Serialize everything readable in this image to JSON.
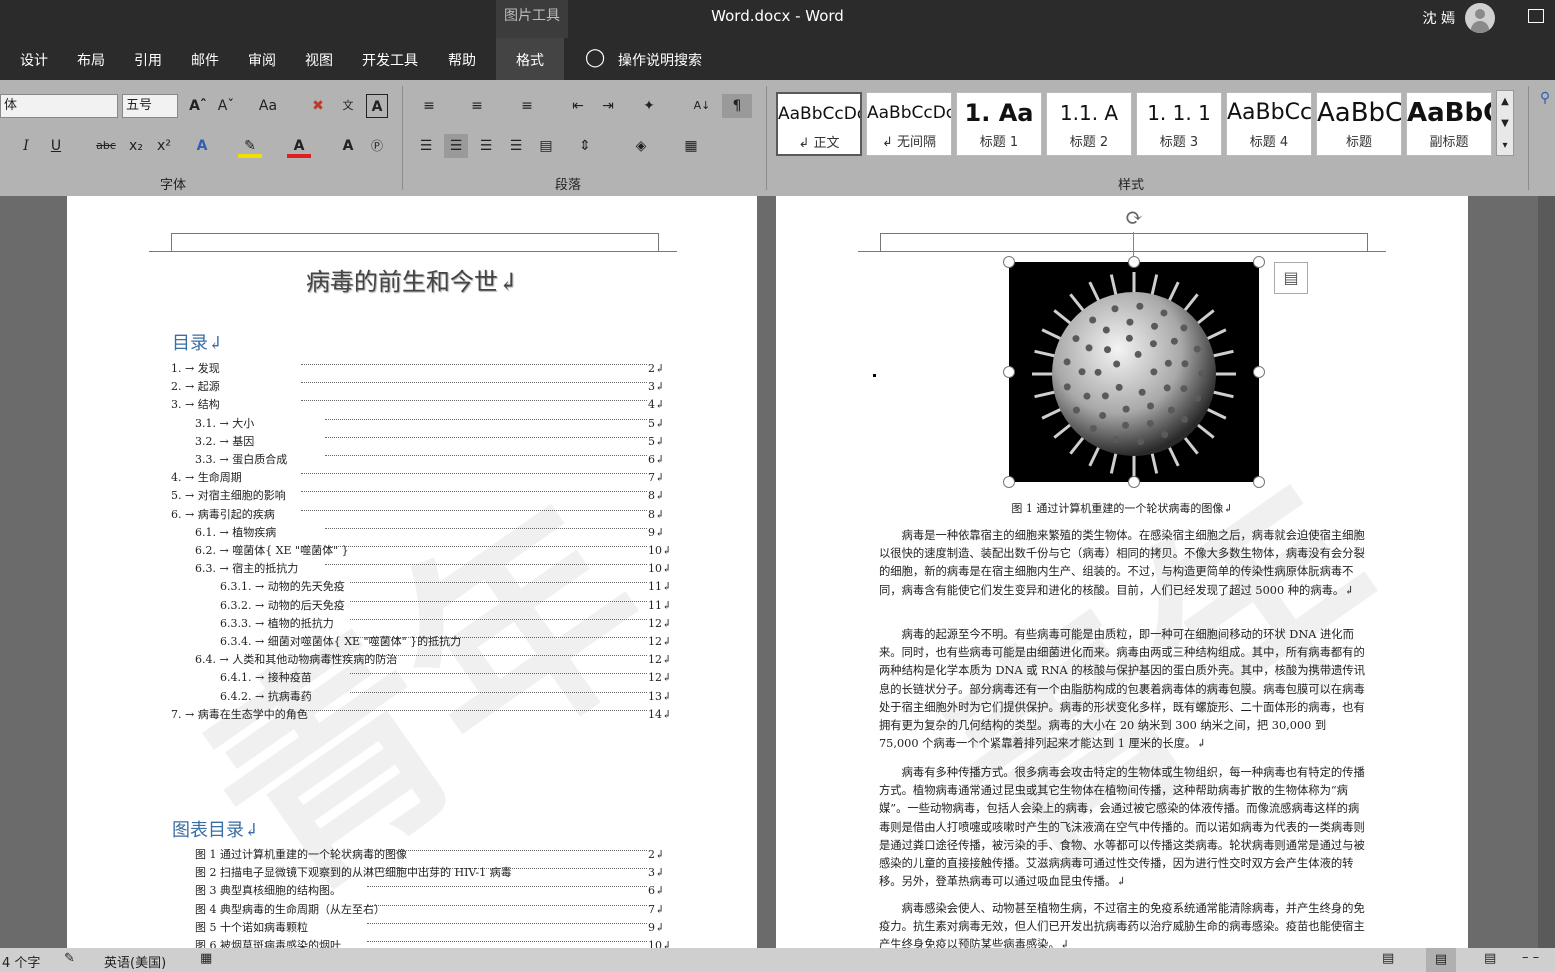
{
  "window": {
    "title": "Word.docx  -  Word",
    "user": "沈 嫣",
    "context_tab": "图片工具"
  },
  "tabs": [
    "设计",
    "布局",
    "引用",
    "邮件",
    "审阅",
    "视图",
    "开发工具",
    "帮助",
    "格式"
  ],
  "tell_me": "操作说明搜索",
  "font": {
    "name": "体",
    "size": "五号",
    "group_label": "字体",
    "aa": "Aa",
    "strike": "abc",
    "sub": "x₂",
    "sup": "x²",
    "A": "A"
  },
  "paragraph": {
    "group_label": "段落"
  },
  "styles": {
    "group_label": "样式",
    "items": [
      {
        "preview": "AaBbCcDc",
        "name": "↲ 正文"
      },
      {
        "preview": "AaBbCcDc",
        "name": "↲ 无间隔"
      },
      {
        "preview": "1.  Aa",
        "name": "标题 1"
      },
      {
        "preview": "1.1.  A",
        "name": "标题 2"
      },
      {
        "preview": "1. 1. 1",
        "name": "标题 3"
      },
      {
        "preview": "AaBbCc",
        "name": "标题 4"
      },
      {
        "preview": "AaBbC",
        "name": "标题"
      },
      {
        "preview": "AaBbC",
        "name": "副标题"
      }
    ]
  },
  "left_page": {
    "doc_title": "病毒的前生和今世↲",
    "toc_heading": "目录↲",
    "toc": [
      {
        "text": "1. → 发现",
        "page": "2↲",
        "level": 0
      },
      {
        "text": "2. → 起源",
        "page": "3↲",
        "level": 0
      },
      {
        "text": "3. → 结构",
        "page": "4↲",
        "level": 0
      },
      {
        "text": "3.1. → 大小",
        "page": "5↲",
        "level": 1
      },
      {
        "text": "3.2. → 基因",
        "page": "5↲",
        "level": 1
      },
      {
        "text": "3.3. → 蛋白质合成",
        "page": "6↲",
        "level": 1
      },
      {
        "text": "4. → 生命周期",
        "page": "7↲",
        "level": 0
      },
      {
        "text": "5. → 对宿主细胞的影响",
        "page": "8↲",
        "level": 0
      },
      {
        "text": "6. → 病毒引起的疾病",
        "page": "8↲",
        "level": 0
      },
      {
        "text": "6.1. → 植物疾病",
        "page": "9↲",
        "level": 1
      },
      {
        "text": "6.2. → 噬菌体{ XE \"噬菌体\" }",
        "page": "10↲",
        "level": 1
      },
      {
        "text": "6.3. → 宿主的抵抗力",
        "page": "10↲",
        "level": 1
      },
      {
        "text": "6.3.1. → 动物的先天免疫",
        "page": "11↲",
        "level": 2
      },
      {
        "text": "6.3.2. → 动物的后天免疫",
        "page": "11↲",
        "level": 2
      },
      {
        "text": "6.3.3. → 植物的抵抗力",
        "page": "12↲",
        "level": 2
      },
      {
        "text": "6.3.4. → 细菌对噬菌体{ XE \"噬菌体\" }的抵抗力",
        "page": "12↲",
        "level": 2
      },
      {
        "text": "6.4. → 人类和其他动物病毒性疾病的防治",
        "page": "12↲",
        "level": 1
      },
      {
        "text": "6.4.1. → 接种疫苗",
        "page": "12↲",
        "level": 2
      },
      {
        "text": "6.4.2. → 抗病毒药",
        "page": "13↲",
        "level": 2
      },
      {
        "text": "7. → 病毒在生态学中的角色",
        "page": "14↲",
        "level": 0
      }
    ],
    "fig_heading": "图表目录↲",
    "figs": [
      {
        "text": "图 1 通过计算机重建的一个轮状病毒的图像",
        "page": "2↲"
      },
      {
        "text": "图 2 扫描电子显微镜下观察到的从淋巴细胞中出芽的 HIV-1 病毒",
        "page": "3↲"
      },
      {
        "text": "图 3 典型真核细胞的结构图。",
        "page": "6↲"
      },
      {
        "text": "图 4 典型病毒的生命周期（从左至右）",
        "page": "7↲"
      },
      {
        "text": "图 5 十个诺如病毒颗粒",
        "page": "9↲"
      },
      {
        "text": "图 6 被烟草斑病毒感染的烟叶",
        "page": "10↲"
      }
    ]
  },
  "right_page": {
    "caption": "图 1 通过计算机重建的一个轮状病毒的图像↲",
    "paragraphs": [
      "病毒是一种依靠宿主的细胞来繁殖的类生物体。在感染宿主细胞之后，病毒就会迫使宿主细胞以很快的速度制造、装配出数千份与它（病毒）相同的拷贝。不像大多数生物体，病毒没有会分裂的细胞，新的病毒是在宿主细胞内生产、组装的。不过，与构造更简单的传染性病原体朊病毒不同，病毒含有能使它们发生变异和进化的核酸。目前，人们已经发现了超过 5000 种的病毒。↲",
      "病毒的起源至今不明。有些病毒可能是由质粒，即一种可在细胞间移动的环状 DNA 进化而来。同时，也有些病毒可能是由细菌进化而来。病毒由两或三种结构组成。其中，所有病毒都有的两种结构是化学本质为 DNA 或 RNA 的核酸与保护基因的蛋白质外壳。其中，核酸为携带遗传讯息的长链状分子。部分病毒还有一个由脂肪构成的包裹着病毒体的病毒包膜。病毒包膜可以在病毒处于宿主细胞外时为它们提供保护。病毒的形状变化多样，既有螺旋形、二十面体形的病毒，也有拥有更为复杂的几何结构的类型。病毒的大小在 20 纳米到 300 纳米之间，把 30,000 到 75,000 个病毒一个个紧靠着排列起来才能达到 1 厘米的长度。↲",
      "病毒有多种传播方式。很多病毒会攻击特定的生物体或生物组织，每一种病毒也有特定的传播方式。植物病毒通常通过昆虫或其它生物体在植物间传播，这种帮助病毒扩散的生物体称为“病媒”。一些动物病毒，包括人会染上的病毒，会通过被它感染的体液传播。而像流感病毒这样的病毒则是借由人打喷嚏或咳嗽时产生的飞沫液滴在空气中传播的。而以诺如病毒为代表的一类病毒则是通过粪口途径传播，被污染的手、食物、水等都可以传播这类病毒。轮状病毒则通常是通过与被感染的儿童的直接接触传播。艾滋病病毒可通过性交传播，因为进行性交时双方会产生体液的转移。另外，登革热病毒可以通过吸血昆虫传播。↲",
      "病毒感染会使人、动物甚至植物生病，不过宿主的免疫系统通常能清除病毒，并产生终身的免疫力。抗生素对病毒无效，但人们已开发出抗病毒药以治疗威胁生命的病毒感染。疫苗也能使宿主产生终身免疫以预防某些病毒感染。↲"
    ]
  },
  "status": {
    "words": "4 个字",
    "lang": "英语(美国)"
  }
}
